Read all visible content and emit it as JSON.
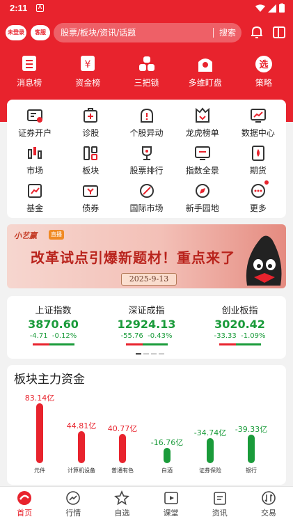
{
  "status_bar": {
    "time": "2:11",
    "notification_glyph": "A"
  },
  "header": {
    "not_logged_in": "未登录",
    "customer_service": "客服",
    "search_placeholder": "股票/板块/资讯/话题",
    "search_button": "搜索",
    "icons": [
      "bell-icon",
      "split-screen-icon"
    ]
  },
  "top_nav": [
    {
      "label": "消息榜",
      "icon": "message-list-icon"
    },
    {
      "label": "资金榜",
      "icon": "money-list-icon"
    },
    {
      "label": "三把锁",
      "icon": "three-locks-icon"
    },
    {
      "label": "多维盯盘",
      "icon": "multi-watch-icon"
    },
    {
      "label": "策略",
      "icon": "strategy-icon",
      "glyph": "选"
    }
  ],
  "grid": [
    [
      {
        "label": "证券开户",
        "icon": "account-icon"
      },
      {
        "label": "诊股",
        "icon": "diagnose-icon"
      },
      {
        "label": "个股异动",
        "icon": "alert-icon"
      },
      {
        "label": "龙虎榜单",
        "icon": "dragon-tiger-icon"
      },
      {
        "label": "数据中心",
        "icon": "data-center-icon"
      }
    ],
    [
      {
        "label": "市场",
        "icon": "market-icon"
      },
      {
        "label": "板块",
        "icon": "sector-icon"
      },
      {
        "label": "股票排行",
        "icon": "ranking-icon"
      },
      {
        "label": "指数全景",
        "icon": "index-panorama-icon"
      },
      {
        "label": "期货",
        "icon": "futures-icon"
      }
    ],
    [
      {
        "label": "基金",
        "icon": "fund-icon"
      },
      {
        "label": "债券",
        "icon": "bond-icon"
      },
      {
        "label": "国际市场",
        "icon": "international-icon"
      },
      {
        "label": "新手园地",
        "icon": "novice-icon"
      },
      {
        "label": "更多",
        "icon": "more-icon",
        "badge": true
      }
    ]
  ],
  "banner": {
    "tag": "小艺赢",
    "tag2": "直播",
    "title": "改革试点引爆新题材！重点来了",
    "date": "2025-9-13"
  },
  "indices": [
    {
      "name": "上证指数",
      "value": "3870.60",
      "change": "-4.71",
      "change_pct": "-0.12%"
    },
    {
      "name": "深证成指",
      "value": "12924.13",
      "change": "-55.76",
      "change_pct": "-0.43%"
    },
    {
      "name": "创业板指",
      "value": "3020.42",
      "change": "-33.33",
      "change_pct": "-1.09%"
    }
  ],
  "fund_flow": {
    "title": "板块主力资金",
    "colors": {
      "inflow": "#e8232d",
      "outflow": "#1a9b3a"
    },
    "items": [
      {
        "name": "元件",
        "value": 83.14,
        "label": "83.14亿"
      },
      {
        "name": "计算机设备",
        "value": 44.81,
        "label": "44.81亿"
      },
      {
        "name": "普通有色",
        "value": 40.77,
        "label": "40.77亿"
      },
      {
        "name": "白酒",
        "value": -16.76,
        "label": "-16.76亿"
      },
      {
        "name": "证券保险",
        "value": -34.74,
        "label": "-34.74亿"
      },
      {
        "name": "银行",
        "value": -39.33,
        "label": "-39.33亿"
      }
    ]
  },
  "tab_bar": [
    {
      "label": "首页",
      "icon": "home-icon",
      "active": true
    },
    {
      "label": "行情",
      "icon": "market-trend-icon"
    },
    {
      "label": "自选",
      "icon": "star-icon"
    },
    {
      "label": "课堂",
      "icon": "classroom-icon"
    },
    {
      "label": "资讯",
      "icon": "news-icon"
    },
    {
      "label": "交易",
      "icon": "trade-icon"
    }
  ]
}
